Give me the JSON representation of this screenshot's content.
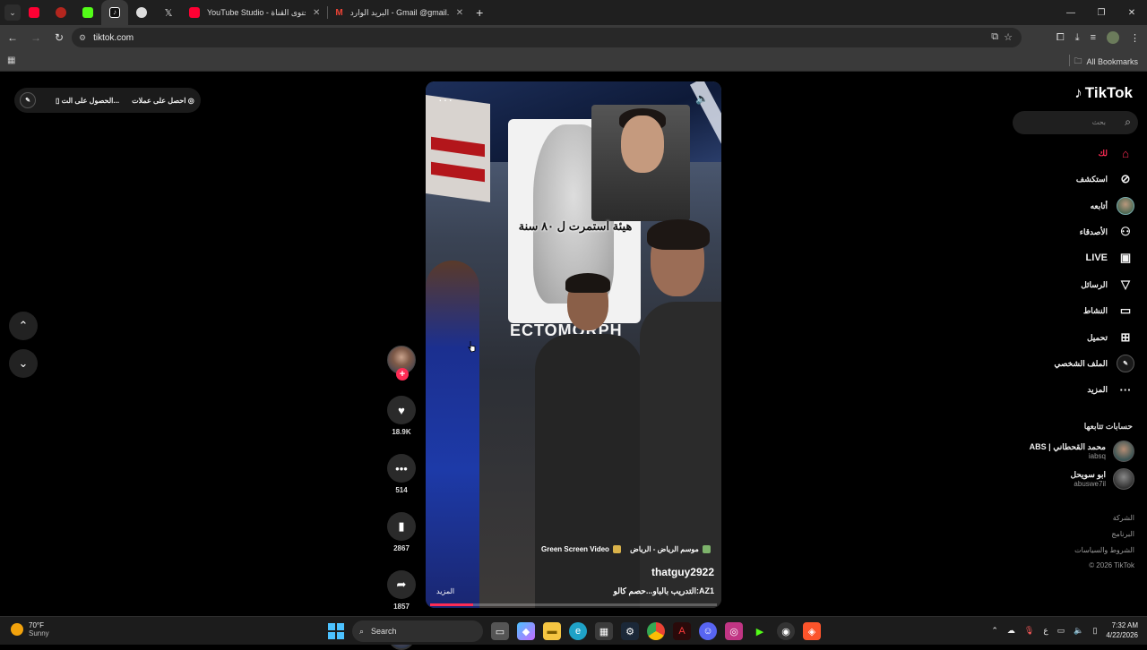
{
  "tabs": {
    "pinned": [
      {
        "name": "youtube-pinned",
        "color": "#ff0033"
      },
      {
        "name": "red-pinned",
        "color": "#b3261e"
      },
      {
        "name": "kick-pinned",
        "color": "#53fc18"
      },
      {
        "name": "tiktok-pinned",
        "color": "#111111"
      },
      {
        "name": "threads-pinned",
        "color": "#222222"
      },
      {
        "name": "x-pinned",
        "color": "#000000"
      }
    ],
    "items": [
      {
        "title": "YouTube Studio - محتوى القناة",
        "close": "✕"
      },
      {
        "title": "البريد الوارد - Gmail @gmail.com",
        "close": "✕"
      }
    ],
    "new_tab": "+"
  },
  "window": {
    "minimize": "—",
    "restore": "❐",
    "close": "✕"
  },
  "address": {
    "url": "tiktok.com"
  },
  "bookmarks": {
    "all_label": "All Bookmarks"
  },
  "promo": {
    "get_app": "الحصول على الت...",
    "get_coins": "احصل على عملات"
  },
  "video": {
    "graphic_caption": "هيئة استمرت ل ٨٠ سنة",
    "graphic_label": "ECTOMORPH",
    "tag_green_screen": "Green Screen Video",
    "tag_location": "موسم الرياض - الرياض",
    "username": "thatguy2922",
    "description": "التدريب بالباو...حصم كالو:AZ1",
    "more_link": "المزيد",
    "progress_fraction": 0.15
  },
  "actions": {
    "likes": "18.9K",
    "comments": "514",
    "saves": "2867",
    "shares": "1857"
  },
  "sidebar": {
    "logo": "TikTok",
    "search_placeholder": "بحث",
    "menu": [
      {
        "label": "لك",
        "icon": "home-icon"
      },
      {
        "label": "استكشف",
        "icon": "compass-icon"
      },
      {
        "label": "أتابعه",
        "icon": "avatar-icon"
      },
      {
        "label": "الأصدقاء",
        "icon": "friends-icon"
      },
      {
        "label": "LIVE",
        "icon": "live-icon"
      },
      {
        "label": "الرسائل",
        "icon": "send-icon"
      },
      {
        "label": "النشاط",
        "icon": "activity-icon"
      },
      {
        "label": "تحميل",
        "icon": "upload-icon"
      },
      {
        "label": "الملف الشخصي",
        "icon": "profile-icon"
      },
      {
        "label": "المزيد",
        "icon": "more-icon"
      }
    ],
    "following_title": "حسابات تتابعها",
    "following": [
      {
        "name": "ABS | محمد القحطاني",
        "handle": "iabsq"
      },
      {
        "name": "ابو سويحل",
        "handle": "abuswe7il"
      }
    ],
    "footer": [
      "الشركة",
      "البرنامج",
      "الشروط والسياسات",
      "© 2026 TikTok"
    ]
  },
  "taskbar": {
    "temp": "70°F",
    "condition": "Sunny",
    "search": "Search",
    "lang": "ع",
    "time": "7:32 AM",
    "date": "4/22/2026"
  }
}
